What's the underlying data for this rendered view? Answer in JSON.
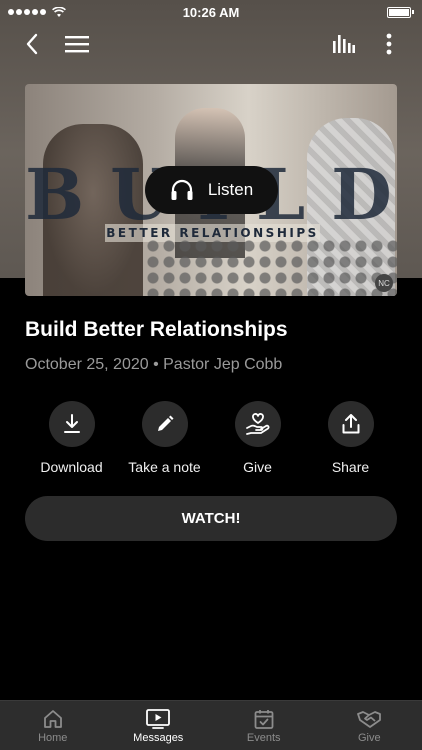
{
  "status_bar": {
    "time": "10:26 AM"
  },
  "topnav": {
    "back_icon": "chevron-left-icon",
    "menu_icon": "hamburger-icon",
    "equalizer_icon": "bars-icon",
    "more_icon": "vertical-dots-icon"
  },
  "artwork": {
    "title_text": "BUILD",
    "subtitle_text": "BETTER RELATIONSHIPS",
    "badge_text": "NC"
  },
  "listen": {
    "label": "Listen",
    "icon": "headphones-icon"
  },
  "message": {
    "title": "Build Better Relationships",
    "meta": "October 25, 2020 • Pastor Jep Cobb"
  },
  "actions": [
    {
      "label": "Download",
      "icon": "download-icon"
    },
    {
      "label": "Take a note",
      "icon": "pencil-icon"
    },
    {
      "label": "Give",
      "icon": "heart-hand-icon"
    },
    {
      "label": "Share",
      "icon": "share-icon"
    }
  ],
  "watch": {
    "label": "WATCH!"
  },
  "tabs": [
    {
      "label": "Home",
      "icon": "home-icon",
      "active": false
    },
    {
      "label": "Messages",
      "icon": "play-screen-icon",
      "active": true
    },
    {
      "label": "Events",
      "icon": "calendar-icon",
      "active": false
    },
    {
      "label": "Give",
      "icon": "handshake-icon",
      "active": false
    }
  ],
  "colors": {
    "background": "#000000",
    "surface": "#2c2c2c",
    "tabbar": "#2d2d2d",
    "muted_text": "#9a9a9a"
  }
}
